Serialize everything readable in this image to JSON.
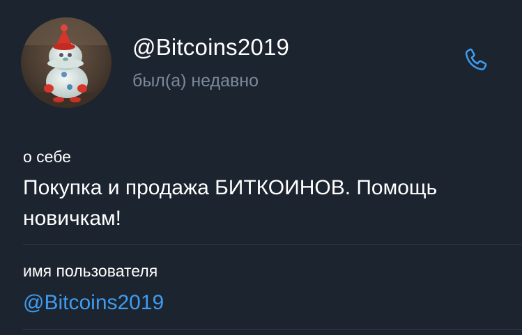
{
  "profile": {
    "name": "@Bitcoins2019",
    "status": "был(а) недавно",
    "avatar_icon": "avatar-photo",
    "call_icon": "phone-icon"
  },
  "about": {
    "label": "о себе",
    "text": "Покупка и продажа БИТКОИНОВ. Помощь новичкам!"
  },
  "username": {
    "label": "имя пользователя",
    "value": "@Bitcoins2019"
  },
  "colors": {
    "background": "#1c242f",
    "accent": "#3f9cf0",
    "secondary_text": "#7b8a99",
    "divider": "#303b48"
  }
}
